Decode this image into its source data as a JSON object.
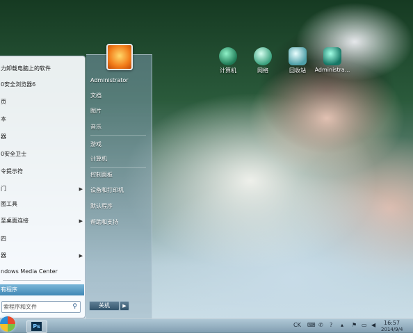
{
  "desktop": {
    "icons": [
      {
        "label": "计算机",
        "icon": "computer-icon"
      },
      {
        "label": "网络",
        "icon": "network-icon"
      },
      {
        "label": "回收站",
        "icon": "recycle-bin-icon"
      },
      {
        "label": "Administra...",
        "icon": "user-folder-icon"
      }
    ]
  },
  "start_menu": {
    "programs": [
      "力卸载电脑上的软件",
      "0安全浏览器6",
      "页",
      "本",
      "器",
      "0安全卫士",
      "令提示符",
      "门",
      "图工具",
      "至桌面连接",
      "四",
      "器",
      "ndows Media Center"
    ],
    "all_programs": "有程序",
    "search_placeholder": "索程序和文件",
    "right_items": [
      "Administrator",
      "文档",
      "图片",
      "音乐",
      "游戏",
      "计算机",
      "控制面板",
      "设备和打印机",
      "默认程序",
      "帮助和支持"
    ],
    "shutdown_label": "关机"
  },
  "taskbar": {
    "pinned_app": "Ps",
    "tray": {
      "ime": "CK",
      "time": "16:57",
      "date": "2014/9/4"
    }
  }
}
